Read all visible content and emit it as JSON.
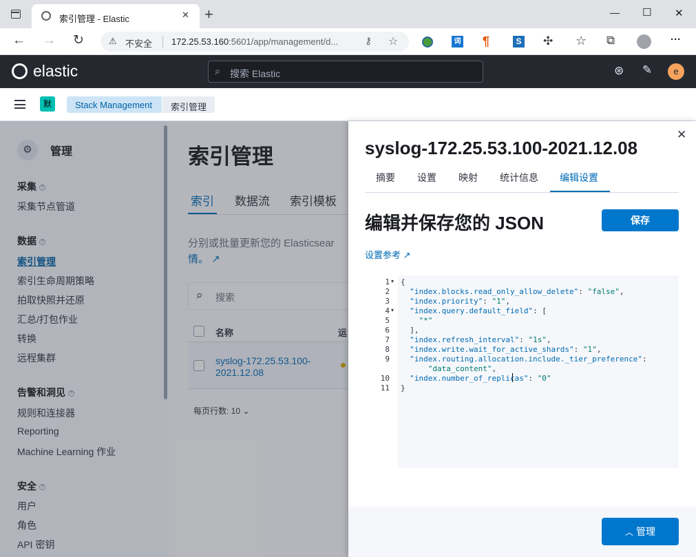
{
  "browser": {
    "tab_title": "索引管理 - Elastic",
    "new_tab": "+",
    "security": "不安全",
    "url_host": "172.25.53.160",
    "url_rest": ":5601/app/management/d...",
    "win_min": "—",
    "win_max": "☐",
    "win_close": "✕",
    "more": "···"
  },
  "kibana": {
    "brand": "elastic",
    "search_placeholder": "搜索 Elastic",
    "avatar": "e",
    "space_badge": "默",
    "breadcrumbs": [
      "Stack Management",
      "索引管理"
    ]
  },
  "sidebar": {
    "title": "管理",
    "sections": [
      {
        "label": "采集",
        "items": [
          "采集节点管道"
        ]
      },
      {
        "label": "数据",
        "items": [
          "索引管理",
          "索引生命周期策略",
          "拍取快照并还原",
          "汇总/打包作业",
          "转换",
          "远程集群"
        ]
      },
      {
        "label": "告警和洞见",
        "items": [
          "规则和连接器",
          "Reporting",
          "Machine Learning 作业"
        ]
      },
      {
        "label": "安全",
        "items": [
          "用户",
          "角色",
          "API 密钥"
        ]
      }
    ],
    "active_item": "索引管理"
  },
  "main": {
    "title": "索引管理",
    "tabs": [
      "索引",
      "数据流",
      "索引模板"
    ],
    "description": "分别或批量更新您的 Elasticsear",
    "description_end": "情。",
    "search_placeholder": "搜索",
    "col_name": "名称",
    "col_status": "运",
    "row_name_1": "syslog-172.25.53.100-",
    "row_name_2": "2021.12.08",
    "rows_per_page": "每页行数: 10"
  },
  "flyout": {
    "title": "syslog-172.25.53.100-2021.12.08",
    "tabs": [
      "摘要",
      "设置",
      "映射",
      "统计信息",
      "编辑设置"
    ],
    "active_tab": "编辑设置",
    "heading": "编辑并保存您的 JSON",
    "save_label": "保存",
    "settings_link": "设置参考",
    "manage_label": "管理",
    "code_lines": [
      {
        "n": "1",
        "fold": true,
        "parts": [
          [
            "p",
            "{"
          ]
        ]
      },
      {
        "n": "2",
        "fold": false,
        "parts": [
          [
            "p",
            "  "
          ],
          [
            "k",
            "\"index.blocks.read_only_allow_delete\""
          ],
          [
            "p",
            ": "
          ],
          [
            "s",
            "\"false\""
          ],
          [
            "p",
            ","
          ]
        ]
      },
      {
        "n": "3",
        "fold": false,
        "parts": [
          [
            "p",
            "  "
          ],
          [
            "k",
            "\"index.priority\""
          ],
          [
            "p",
            ": "
          ],
          [
            "s",
            "\"1\""
          ],
          [
            "p",
            ","
          ]
        ]
      },
      {
        "n": "4",
        "fold": true,
        "parts": [
          [
            "p",
            "  "
          ],
          [
            "k",
            "\"index.query.default_field\""
          ],
          [
            "p",
            ": ["
          ]
        ]
      },
      {
        "n": "5",
        "fold": false,
        "parts": [
          [
            "p",
            "    "
          ],
          [
            "s",
            "\"*\""
          ]
        ]
      },
      {
        "n": "6",
        "fold": false,
        "parts": [
          [
            "p",
            "  ],"
          ]
        ]
      },
      {
        "n": "7",
        "fold": false,
        "parts": [
          [
            "p",
            "  "
          ],
          [
            "k",
            "\"index.refresh_interval\""
          ],
          [
            "p",
            ": "
          ],
          [
            "s",
            "\"1s\""
          ],
          [
            "p",
            ","
          ]
        ]
      },
      {
        "n": "8",
        "fold": false,
        "parts": [
          [
            "p",
            "  "
          ],
          [
            "k",
            "\"index.write.wait_for_active_shards\""
          ],
          [
            "p",
            ": "
          ],
          [
            "s",
            "\"1\""
          ],
          [
            "p",
            ","
          ]
        ]
      },
      {
        "n": "9",
        "fold": false,
        "parts": [
          [
            "p",
            "  "
          ],
          [
            "k",
            "\"index.routing.allocation.include._tier_preference\""
          ],
          [
            "p",
            ":"
          ]
        ]
      },
      {
        "n": "",
        "fold": false,
        "parts": [
          [
            "p",
            "      "
          ],
          [
            "s",
            "\"data_content\""
          ],
          [
            "p",
            ","
          ]
        ]
      },
      {
        "n": "10",
        "fold": false,
        "parts": [
          [
            "p",
            "  "
          ],
          [
            "k",
            "\"index.number_of_replicas\""
          ],
          [
            "p",
            ": "
          ],
          [
            "s",
            "\"0\""
          ]
        ]
      },
      {
        "n": "11",
        "fold": false,
        "parts": [
          [
            "p",
            "}"
          ]
        ]
      }
    ]
  }
}
